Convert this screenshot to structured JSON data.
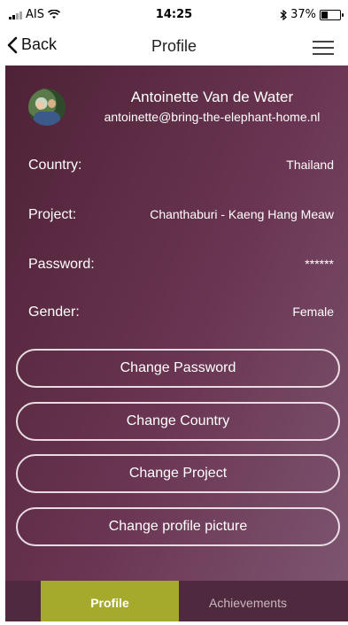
{
  "status_bar": {
    "carrier": "AIS",
    "time": "14:25",
    "battery_text": "37%",
    "battery_level": 0.37,
    "icons": [
      "signal-icon",
      "wifi-icon",
      "bluetooth-icon",
      "battery-icon"
    ]
  },
  "nav": {
    "back_label": "Back",
    "title": "Profile",
    "icons": [
      "chevron-left-icon",
      "menu-icon"
    ]
  },
  "profile": {
    "name": "Antoinette Van de Water",
    "email": "antoinette@bring-the-elephant-home.nl",
    "fields": [
      {
        "label": "Country:",
        "value": "Thailand"
      },
      {
        "label": "Project:",
        "value": "Chanthaburi - Kaeng Hang Meaw"
      },
      {
        "label": "Password:",
        "value": "******"
      },
      {
        "label": "Gender:",
        "value": "Female"
      }
    ]
  },
  "actions": {
    "change_password": "Change Password",
    "change_country": "Change Country",
    "change_project": "Change Project",
    "change_picture": "Change profile picture"
  },
  "tabs": [
    {
      "label": "Profile",
      "active": true
    },
    {
      "label": "Achievements",
      "active": false
    }
  ],
  "colors": {
    "content_gradient_start": "#4e2236",
    "content_gradient_end": "#7d5570",
    "active_tab": "#a6aa2c",
    "tab_bar": "#4f2a3e"
  }
}
